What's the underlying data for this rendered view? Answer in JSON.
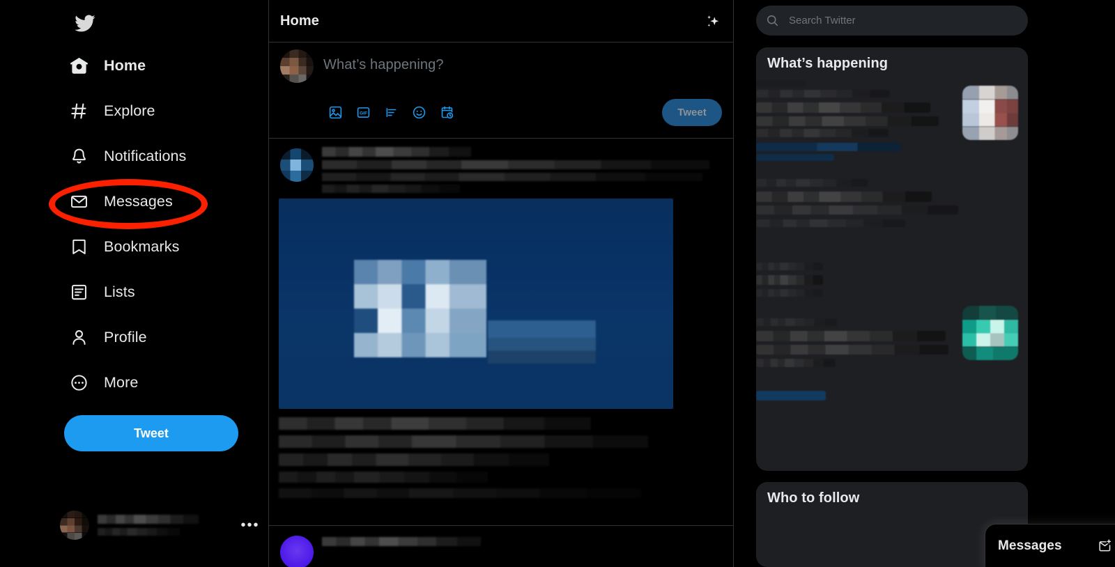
{
  "app": {
    "name": "Twitter",
    "theme": "dark",
    "accent_color": "#1d9bf0",
    "background_color": "#000000",
    "panel_color": "#1e1f23",
    "border_color": "#2f3336",
    "text_primary": "#e7e9ea",
    "text_secondary": "#71767b",
    "annotation_color": "#fa2000"
  },
  "sidebar": {
    "logo_icon": "twitter-bird-icon",
    "items": [
      {
        "label": "Home",
        "icon": "home-icon",
        "active": true
      },
      {
        "label": "Explore",
        "icon": "hashtag-icon",
        "active": false
      },
      {
        "label": "Notifications",
        "icon": "bell-icon",
        "active": false
      },
      {
        "label": "Messages",
        "icon": "envelope-icon",
        "active": false,
        "annotated": true
      },
      {
        "label": "Bookmarks",
        "icon": "bookmark-icon",
        "active": false
      },
      {
        "label": "Lists",
        "icon": "list-icon",
        "active": false
      },
      {
        "label": "Profile",
        "icon": "person-icon",
        "active": false
      },
      {
        "label": "More",
        "icon": "more-circle-icon",
        "active": false
      }
    ],
    "tweet_button_label": "Tweet",
    "account": {
      "name": "",
      "handle": "",
      "avatar": "pixelated-avatar",
      "more_icon": "more-dots-icon",
      "more_label": "•••"
    }
  },
  "main": {
    "header": {
      "title": "Home",
      "sparkle_icon": "sparkle-icon"
    },
    "compose": {
      "avatar": "pixelated-avatar",
      "placeholder": "What’s happening?",
      "value": "",
      "tweet_button_label": "Tweet",
      "tweet_button_disabled": true,
      "toolbar_icons": [
        {
          "name": "media-image-icon",
          "label": "Media"
        },
        {
          "name": "gif-icon",
          "label": "GIF"
        },
        {
          "name": "poll-icon",
          "label": "Poll"
        },
        {
          "name": "emoji-icon",
          "label": "Emoji"
        },
        {
          "name": "schedule-icon",
          "label": "Schedule"
        }
      ]
    },
    "feed": [
      {
        "avatar": "pixelated-blue-avatar",
        "display_name": "",
        "text": "",
        "media": "pixelated-blue-image-card"
      },
      {
        "avatar": "purple-avatar",
        "display_name": "",
        "text": ""
      }
    ]
  },
  "right": {
    "search": {
      "placeholder": "Search Twitter",
      "value": "",
      "icon": "search-icon"
    },
    "whats_happening": {
      "title": "What’s happening",
      "items_redacted": true
    },
    "who_to_follow": {
      "title": "Who to follow",
      "items_redacted": true
    },
    "messages_dock": {
      "title": "Messages",
      "new_message_icon": "new-message-envelope-icon",
      "expand_icon": "chevron-up-icon"
    }
  }
}
